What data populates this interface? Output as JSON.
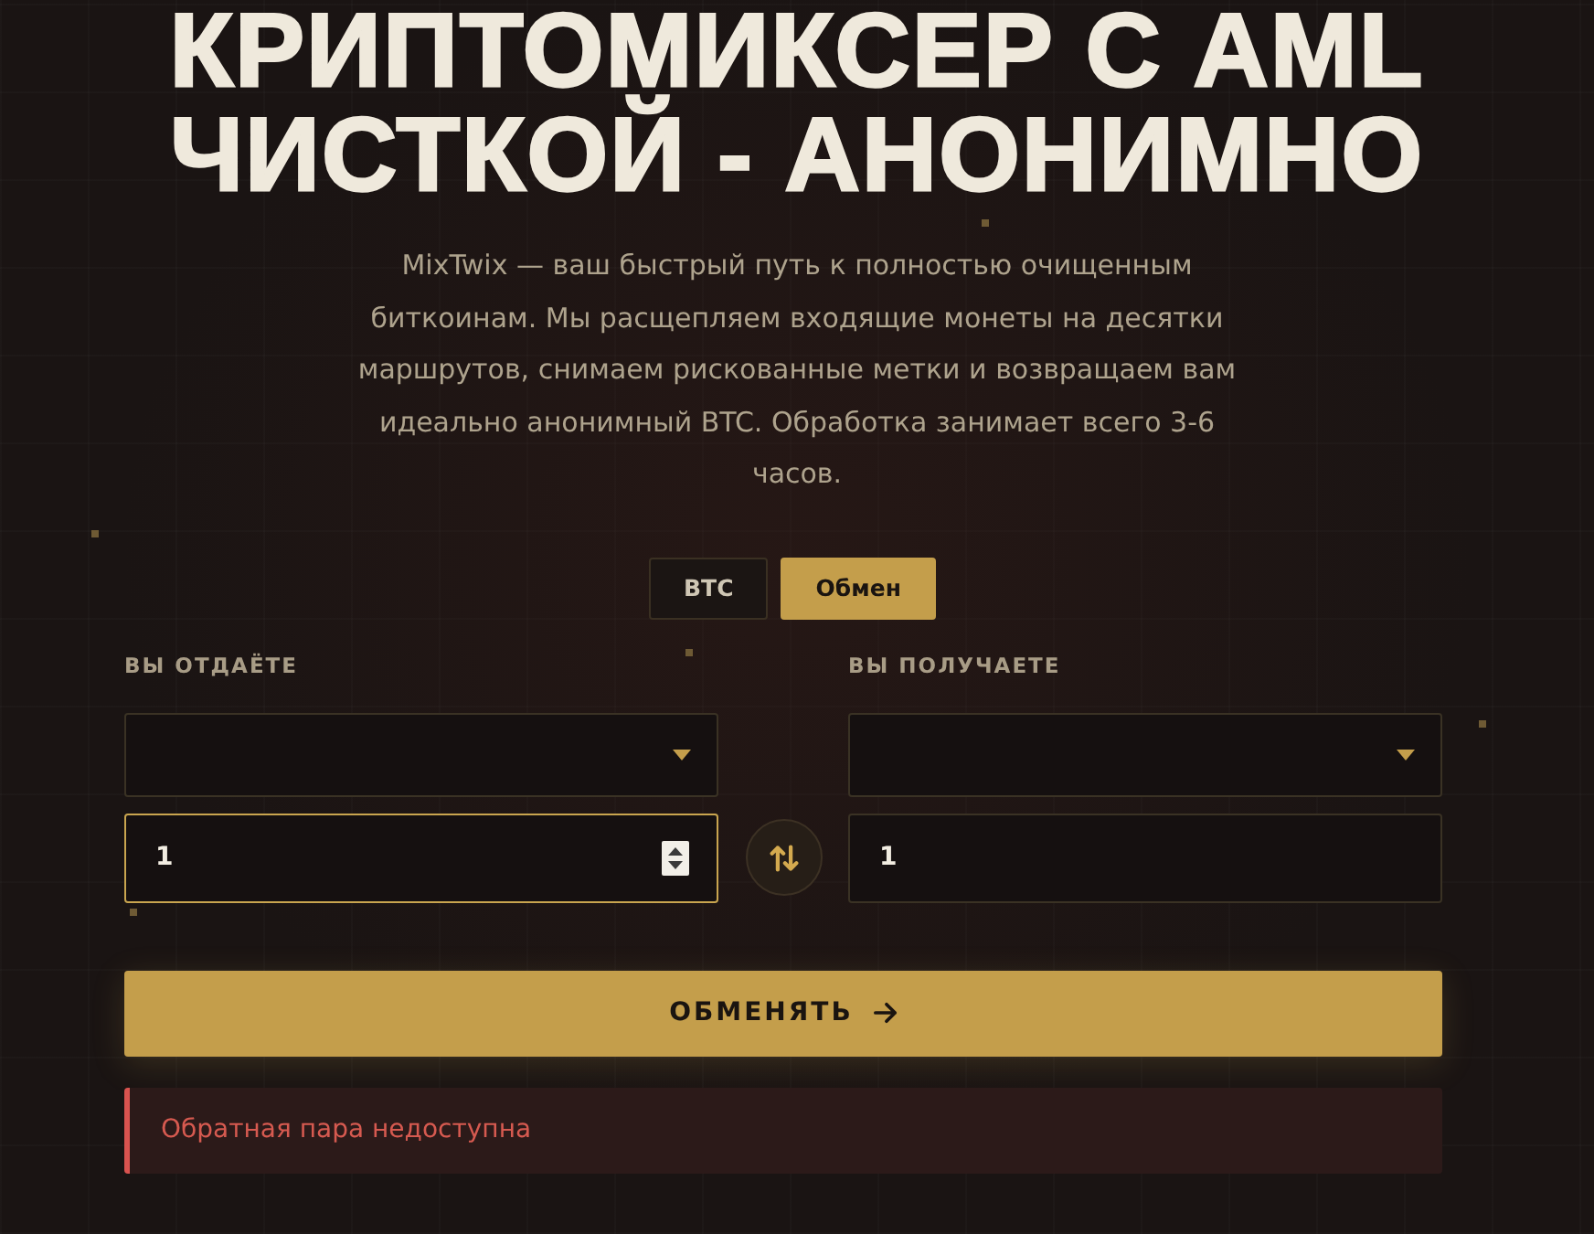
{
  "hero": {
    "title": "КРИПТОМИКСЕР С AML ЧИСТКОЙ - АНОНИМНО",
    "description": "MixTwix — ваш быстрый путь к полностью очищенным биткоинам. Мы расщепляем входящие монеты на десятки маршрутов, снимаем рискованные метки и возвращаем вам идеально анонимный BTC. Обработка занимает всего 3-6 часов."
  },
  "mode_tabs": [
    {
      "label": "BTC",
      "selected": false
    },
    {
      "label": "Обмен",
      "selected": true
    }
  ],
  "exchange": [
    {
      "label": "ВЫ ОТДАЁТЕ",
      "amount": "1",
      "focused": true
    },
    {
      "label": "ВЫ ПОЛУЧАЕТЕ",
      "amount": "1",
      "focused": false
    }
  ],
  "submit_button": {
    "label": "ОБМЕНЯТЬ"
  },
  "error": {
    "message": "Обратная пара недоступна"
  }
}
